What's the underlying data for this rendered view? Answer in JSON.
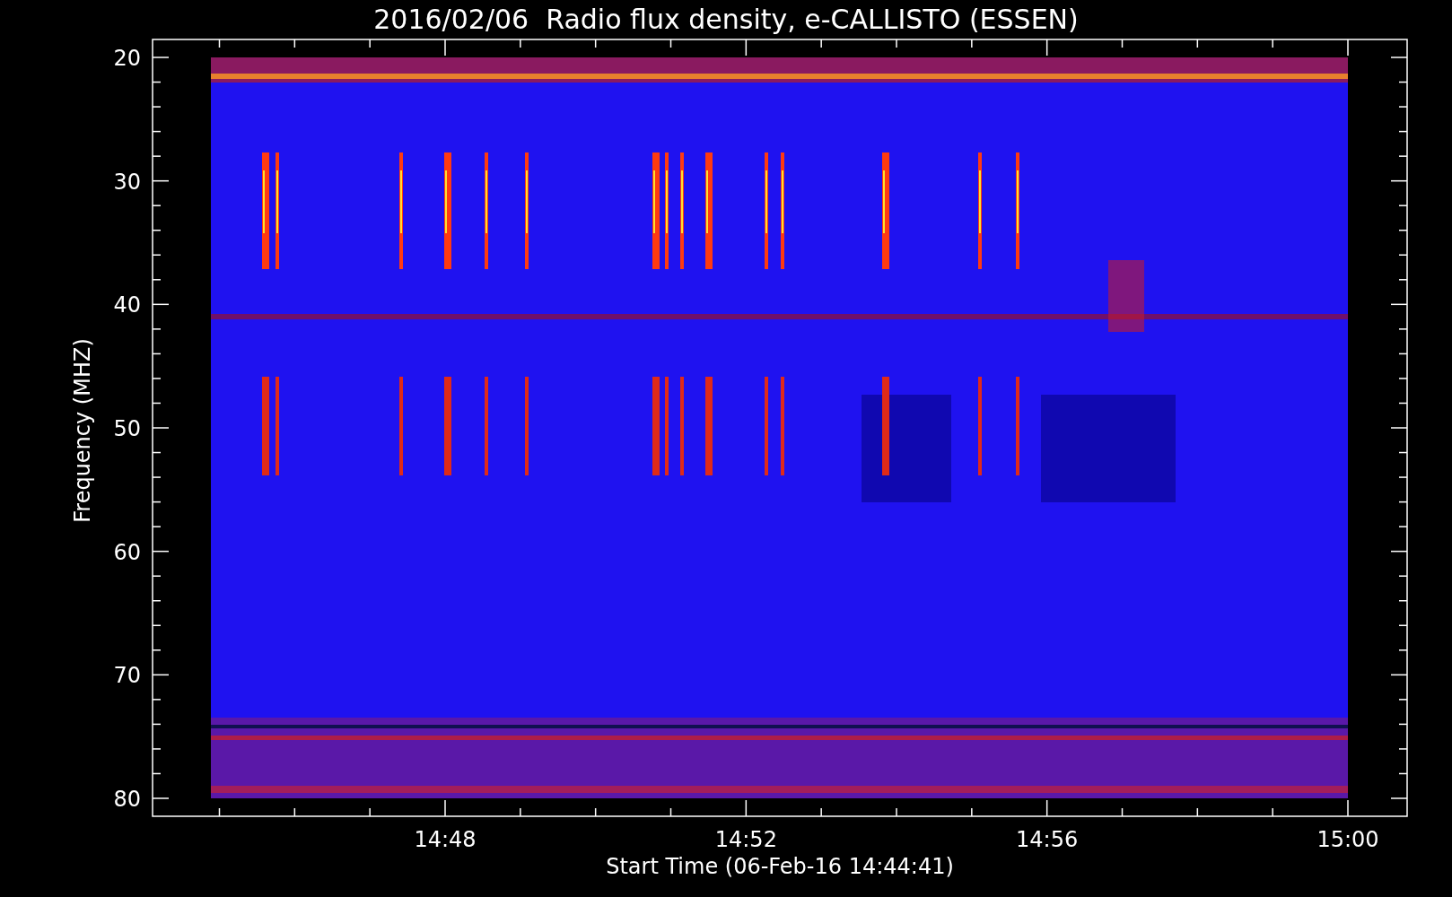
{
  "plot": {
    "title": "2016/02/06  Radio flux density, e-CALLISTO (ESSEN)",
    "ylabel": "Frequency (MHZ)",
    "xlabel": "Start Time (06-Feb-16 14:44:41)",
    "yticks": [
      "20",
      "30",
      "40",
      "50",
      "60",
      "70",
      "80"
    ],
    "xticks": [
      "14:48",
      "14:52",
      "14:56",
      "15:00"
    ]
  }
}
